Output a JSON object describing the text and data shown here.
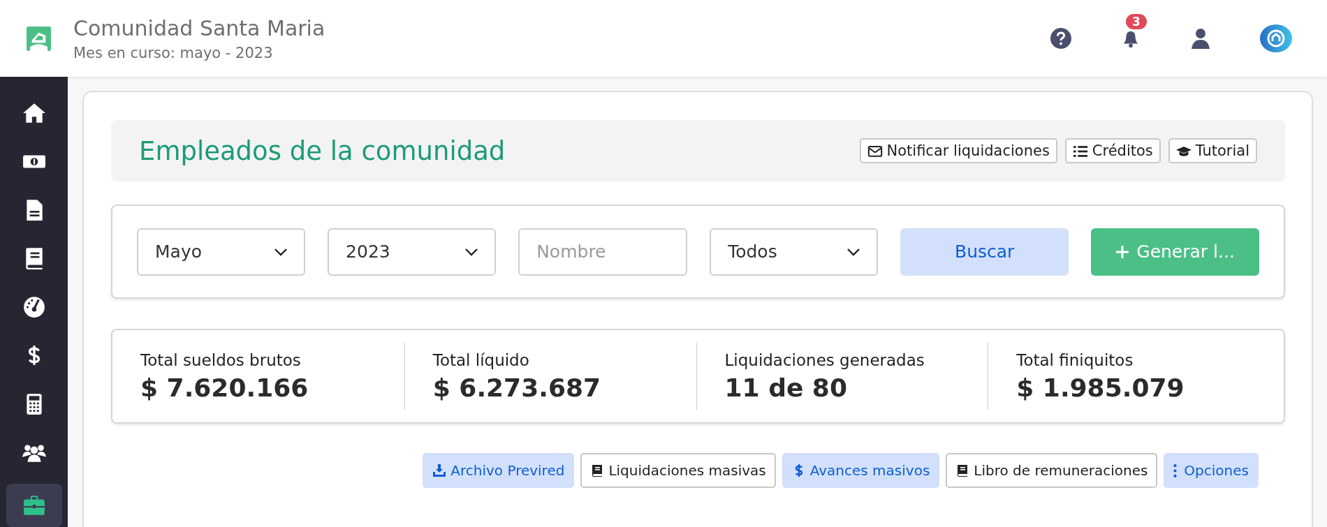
{
  "header": {
    "title": "Comunidad Santa Maria",
    "subtitle": "Mes en curso: mayo - 2023",
    "notifications_badge": "3"
  },
  "sidebar": {
    "items": [
      {
        "selected": false
      },
      {
        "selected": false
      },
      {
        "selected": false
      },
      {
        "selected": false
      },
      {
        "selected": false
      },
      {
        "selected": false
      },
      {
        "selected": false
      },
      {
        "selected": false
      },
      {
        "selected": true
      }
    ]
  },
  "page_title": "Empleados de la comunidad",
  "title_buttons": [
    "Notificar liquidaciones",
    "Créditos",
    "Tutorial"
  ],
  "filters": {
    "month": "Mayo",
    "year": "2023",
    "name_placeholder": "Nombre",
    "status": "Todos",
    "search_button": "Buscar",
    "generate_button": "Generar l..."
  },
  "stats": [
    {
      "label": "Total sueldos brutos",
      "value": "$ 7.620.166"
    },
    {
      "label": "Total líquido",
      "value": "$ 6.273.687"
    },
    {
      "label": "Liquidaciones generadas",
      "value": "11 de 80"
    },
    {
      "label": "Total finiquitos",
      "value": "$ 1.985.079"
    }
  ],
  "actions": [
    {
      "label": "Archivo Previred",
      "kind": "soft"
    },
    {
      "label": "Liquidaciones masivas",
      "kind": "outline"
    },
    {
      "label": "Avances masivos",
      "kind": "soft"
    },
    {
      "label": "Libro de remuneraciones",
      "kind": "outline"
    },
    {
      "label": "Opciones",
      "kind": "soft"
    }
  ]
}
